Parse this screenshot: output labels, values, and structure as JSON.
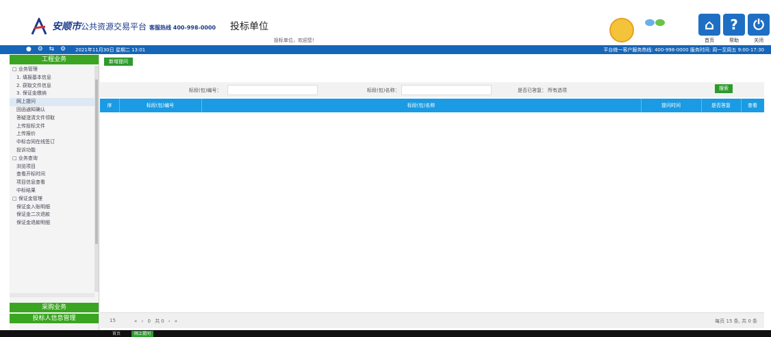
{
  "header": {
    "brand_city": "安顺市",
    "brand_rest": "公共资源交易平台",
    "hotline": "客服热线 400-998-0000",
    "role_title": "投标单位",
    "user_line": "投标单位，欢迎您！",
    "top_buttons": [
      {
        "glyph": "⌂",
        "label": "首页",
        "icon": "home-icon"
      },
      {
        "glyph": "?",
        "label": "帮助",
        "icon": "help-icon"
      },
      {
        "glyph": "⏻",
        "label": "关闭",
        "icon": "power-icon"
      }
    ]
  },
  "status_bar": {
    "icons": "● ⚙ ⇆ ⚙",
    "date": "2021年11月30日 星期二 13:01",
    "right_text": "平台统一客户服务热线: 400-998-0000 服务时间: 周一至周五 9:00-17:30"
  },
  "sidebar": {
    "header": "工程业务",
    "items": [
      {
        "label": "□ 业务管理",
        "type": "group"
      },
      {
        "label": "1. 填报基本信息",
        "type": "child"
      },
      {
        "label": "2. 获取文件信息",
        "type": "child"
      },
      {
        "label": "3. 保证金缴纳",
        "type": "child"
      },
      {
        "label": "网上提问",
        "type": "child",
        "active": true
      },
      {
        "label": "回函通知确认",
        "type": "child"
      },
      {
        "label": "答疑澄清文件领取",
        "type": "child"
      },
      {
        "label": "上传投标文件",
        "type": "child"
      },
      {
        "label": "上传报价",
        "type": "child"
      },
      {
        "label": "中标合同在线签订",
        "type": "child"
      },
      {
        "label": "投诉功能",
        "type": "child"
      },
      {
        "label": "□ 业务查询",
        "type": "group"
      },
      {
        "label": "浏览项目",
        "type": "child"
      },
      {
        "label": "查看开标时间",
        "type": "child"
      },
      {
        "label": "项目信息查看",
        "type": "child"
      },
      {
        "label": "中标结果",
        "type": "child"
      },
      {
        "label": "□ 保证金管理",
        "type": "group"
      },
      {
        "label": "保证金入账明细",
        "type": "child"
      },
      {
        "label": "保证金二次退款",
        "type": "child"
      },
      {
        "label": "保证金退款明细",
        "type": "child"
      }
    ],
    "footer_1": "采购业务",
    "footer_2": "投标人信息管理"
  },
  "toolbar": {
    "add_label": "新增提问"
  },
  "search": {
    "code_label": "标段(包)编号：",
    "name_label": "标段(包)名称：",
    "replied_label": "是否已答复：",
    "replied_value": "所有选项",
    "button_label": "搜索"
  },
  "table": {
    "columns": [
      "序",
      "标段(包)编号",
      "标段(包)名称",
      "提问时间",
      "是否答复",
      "查看"
    ]
  },
  "pager": {
    "page_size": "15",
    "nav": "« ‹ 0 共0 › »",
    "info": "每页 15 条, 共 0 条"
  },
  "bottom_tabs": [
    "首页",
    "网上提问"
  ]
}
